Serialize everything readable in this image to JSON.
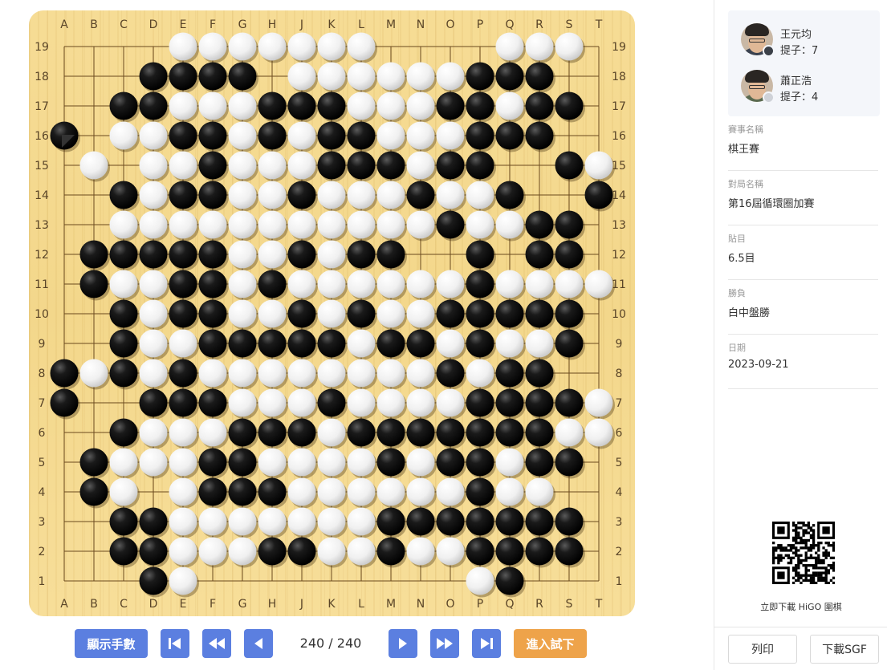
{
  "board": {
    "size": 19,
    "columns": [
      "A",
      "B",
      "C",
      "D",
      "E",
      "F",
      "G",
      "H",
      "J",
      "K",
      "L",
      "M",
      "N",
      "O",
      "P",
      "Q",
      "R",
      "S",
      "T"
    ],
    "rows": [
      "19",
      "18",
      "17",
      "16",
      "15",
      "14",
      "13",
      "12",
      "11",
      "10",
      "9",
      "8",
      "7",
      "6",
      "5",
      "4",
      "3",
      "2",
      "1"
    ],
    "stones": [
      "....ooooooo....ooo.",
      "...xxxx.ooooooxxx..",
      "..xxoooxxxoooxxoxx.",
      "x.ooxxoxoxxoooxxx..",
      ".o.ooxoooxxxoxx..xo",
      "..xoxxooxoooxoox..x",
      "..oooooooooooxooxx.",
      ".xxxxxooxoxx..x.xx.",
      ".xooxxoxooooooxoooo",
      "..xoxxooxoxooxxxxx.",
      "..xooxxxxxoxxoxoox.",
      "xoxoxooooooooxoxx..",
      "x..xxxoooxooooxxxxo",
      "..xoooxxxoxxxxxxxoo",
      ".xoooxxooooxoxxoxx.",
      ".xo.oxxxooooooxoo..",
      "..xxoooooooxxxxxxx.",
      "..xxoooxxooxooxxxx.",
      "...xo.........ox..."
    ],
    "last_move": {
      "col": "A",
      "row": "16"
    },
    "star_point_mark": {
      "col": "Q",
      "row": "4"
    }
  },
  "controls": {
    "show_moves_label": "顯示手數",
    "first_icon": "skip-to-first-icon",
    "prev10_icon": "fast-backward-icon",
    "prev_icon": "step-backward-icon",
    "move_counter": "240 / 240",
    "next_icon": "step-forward-icon",
    "next10_icon": "fast-forward-icon",
    "last_icon": "skip-to-last-icon",
    "try_label": "進入試下",
    "blue": "#5b7fe0",
    "orange": "#eea34a"
  },
  "players": [
    {
      "name": "王元均",
      "captures": "提子：7",
      "stone_color": "black"
    },
    {
      "name": "蕭正浩",
      "captures": "提子：4",
      "stone_color": "white"
    }
  ],
  "info": [
    {
      "label": "賽事名稱",
      "value": "棋王賽"
    },
    {
      "label": "對局名稱",
      "value": "第16屆循環圈加賽"
    },
    {
      "label": "貼目",
      "value": "6.5目"
    },
    {
      "label": "勝負",
      "value": "白中盤勝"
    },
    {
      "label": "日期",
      "value": "2023-09-21"
    }
  ],
  "qr_caption": "立即下載 HiGO 圍棋",
  "footer": {
    "print_label": "列印",
    "download_label": "下載SGF"
  }
}
